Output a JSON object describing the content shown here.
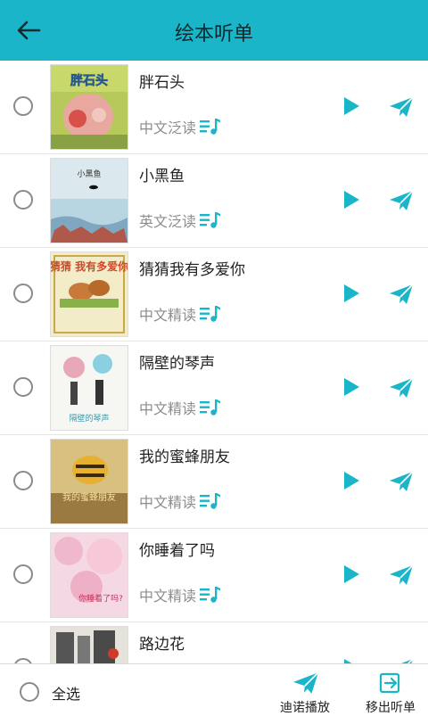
{
  "header": {
    "title": "绘本听单"
  },
  "books": [
    {
      "title": "胖石头",
      "type": "中文泛读",
      "cover_text": "胖石头"
    },
    {
      "title": "小黑鱼",
      "type": "英文泛读",
      "cover_text": "小黑鱼"
    },
    {
      "title": "猜猜我有多爱你",
      "type": "中文精读",
      "cover_text": "猜猜 我有多爱你"
    },
    {
      "title": "隔壁的琴声",
      "type": "中文精读",
      "cover_text": "隔壁的琴声"
    },
    {
      "title": "我的蜜蜂朋友",
      "type": "中文精读",
      "cover_text": "我的蜜蜂朋友"
    },
    {
      "title": "你睡着了吗",
      "type": "中文精读",
      "cover_text": "你睡着了吗?"
    },
    {
      "title": "路边花",
      "type": "",
      "cover_text": ""
    }
  ],
  "bottom": {
    "select_all": "全选",
    "play_label": "迪诺播放",
    "remove_label": "移出听单"
  },
  "colors": {
    "accent": "#1ab5c9",
    "icon": "#1ab5c9"
  }
}
